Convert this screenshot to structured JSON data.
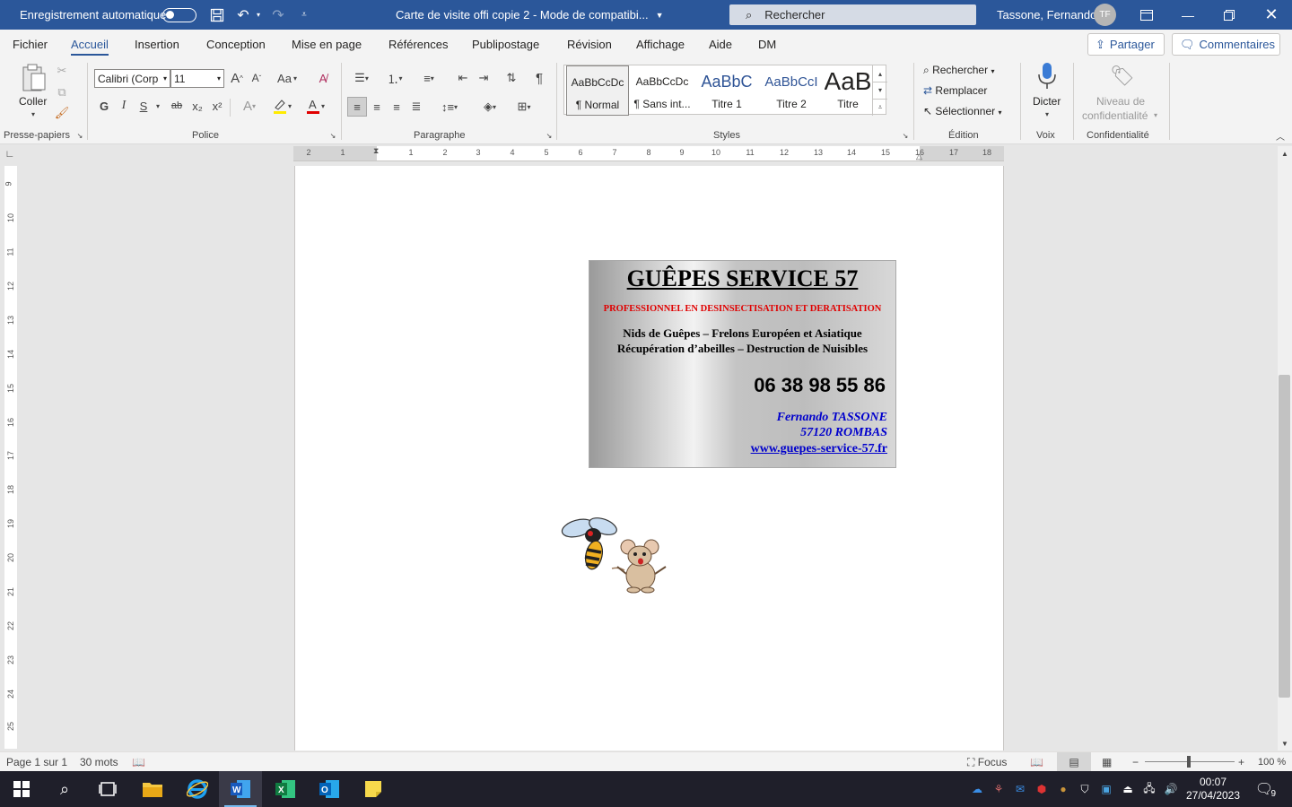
{
  "titlebar": {
    "autosave_label": "Enregistrement automatique",
    "doc_title": "Carte de visite offi copie 2  -  Mode de compatibi...",
    "search_placeholder": "Rechercher",
    "user_name": "Tassone, Fernando",
    "user_initials": "TF"
  },
  "tabs": [
    "Fichier",
    "Accueil",
    "Insertion",
    "Conception",
    "Mise en page",
    "Références",
    "Publipostage",
    "Révision",
    "Affichage",
    "Aide",
    "DM"
  ],
  "active_tab": "Accueil",
  "actions": {
    "share": "Partager",
    "comments": "Commentaires"
  },
  "ribbon": {
    "clipboard": {
      "paste": "Coller",
      "label": "Presse-papiers"
    },
    "font": {
      "name": "Calibri (Corp",
      "size": "11",
      "label": "Police",
      "bold": "G",
      "italic": "I",
      "underline": "S",
      "strike": "ab",
      "sub": "x₂",
      "sup": "x²",
      "grow": "A",
      "shrink": "A",
      "case": "Aa"
    },
    "paragraph": {
      "label": "Paragraphe"
    },
    "styles": {
      "label": "Styles",
      "items": [
        {
          "sample": "AaBbCcDc",
          "name": "¶ Normal"
        },
        {
          "sample": "AaBbCcDc",
          "name": "¶ Sans int..."
        },
        {
          "sample": "AaBbC",
          "name": "Titre 1"
        },
        {
          "sample": "AaBbCcI",
          "name": "Titre 2"
        },
        {
          "sample": "AaB",
          "name": "Titre"
        }
      ]
    },
    "editing": {
      "label": "Édition",
      "find": "Rechercher",
      "replace": "Remplacer",
      "select": "Sélectionner"
    },
    "voice": {
      "label": "Voix",
      "dictate": "Dicter"
    },
    "sensitivity": {
      "label": "Confidentialité",
      "line1": "Niveau de",
      "line2": "confidentialité"
    }
  },
  "ruler": {
    "h_marks": [
      "2",
      "1",
      "1",
      "2",
      "3",
      "4",
      "5",
      "6",
      "7",
      "8",
      "9",
      "10",
      "11",
      "12",
      "13",
      "14",
      "15",
      "16",
      "17",
      "18"
    ],
    "v_marks": [
      "9",
      "10",
      "11",
      "12",
      "13",
      "14",
      "15",
      "16",
      "17",
      "18",
      "19",
      "20",
      "21",
      "22",
      "23",
      "24",
      "25"
    ]
  },
  "card": {
    "title": "GUÊPES SERVICE 57",
    "subtitle": "PROFESSIONNEL EN DESINSECTISATION  ET DERATISATION",
    "line1": "Nids de Guêpes – Frelons Européen et Asiatique",
    "line2": "Récupération d’abeilles – Destruction de Nuisibles",
    "phone": "06 38 98 55 86",
    "name": "Fernando TASSONE",
    "city": "57120 ROMBAS",
    "website": "www.guepes-service-57.fr"
  },
  "status": {
    "page": "Page 1 sur 1",
    "words": "30 mots",
    "focus": "Focus",
    "zoom": "100 %"
  },
  "taskbar": {
    "time": "00:07",
    "date": "27/04/2023",
    "notifications": "9"
  },
  "colors": {
    "word_blue": "#2b579a",
    "card_red": "#e00000",
    "card_blue": "#0000cc"
  }
}
